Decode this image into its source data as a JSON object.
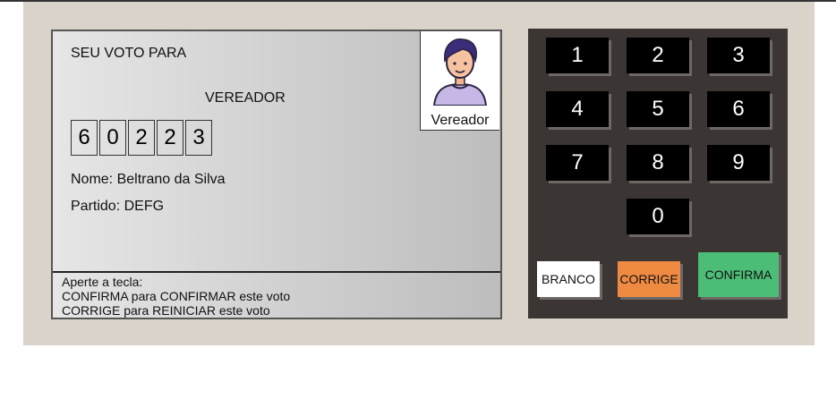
{
  "screen": {
    "vote_for": "SEU VOTO PARA",
    "role": "VEREADOR",
    "digits": [
      "6",
      "0",
      "2",
      "2",
      "3"
    ],
    "name": "Nome: Beltrano da Silva",
    "party": "Partido: DEFG",
    "photo_caption": "Vereador",
    "instructions": [
      "Aperte a tecla:",
      "CONFIRMA para CONFIRMAR este voto",
      "CORRIGE para REINICIAR este voto"
    ]
  },
  "keypad": {
    "keys": [
      "1",
      "2",
      "3",
      "4",
      "5",
      "6",
      "7",
      "8",
      "9",
      "0"
    ],
    "branco": "BRANCO",
    "corrige": "CORRIGE",
    "confirma": "CONFIRMA"
  },
  "colors": {
    "cabinet": "#d9d3c9",
    "keypad_bg": "#3b3533",
    "branco": "#ffffff",
    "corrige": "#ef8a42",
    "confirma": "#4cbd76"
  }
}
